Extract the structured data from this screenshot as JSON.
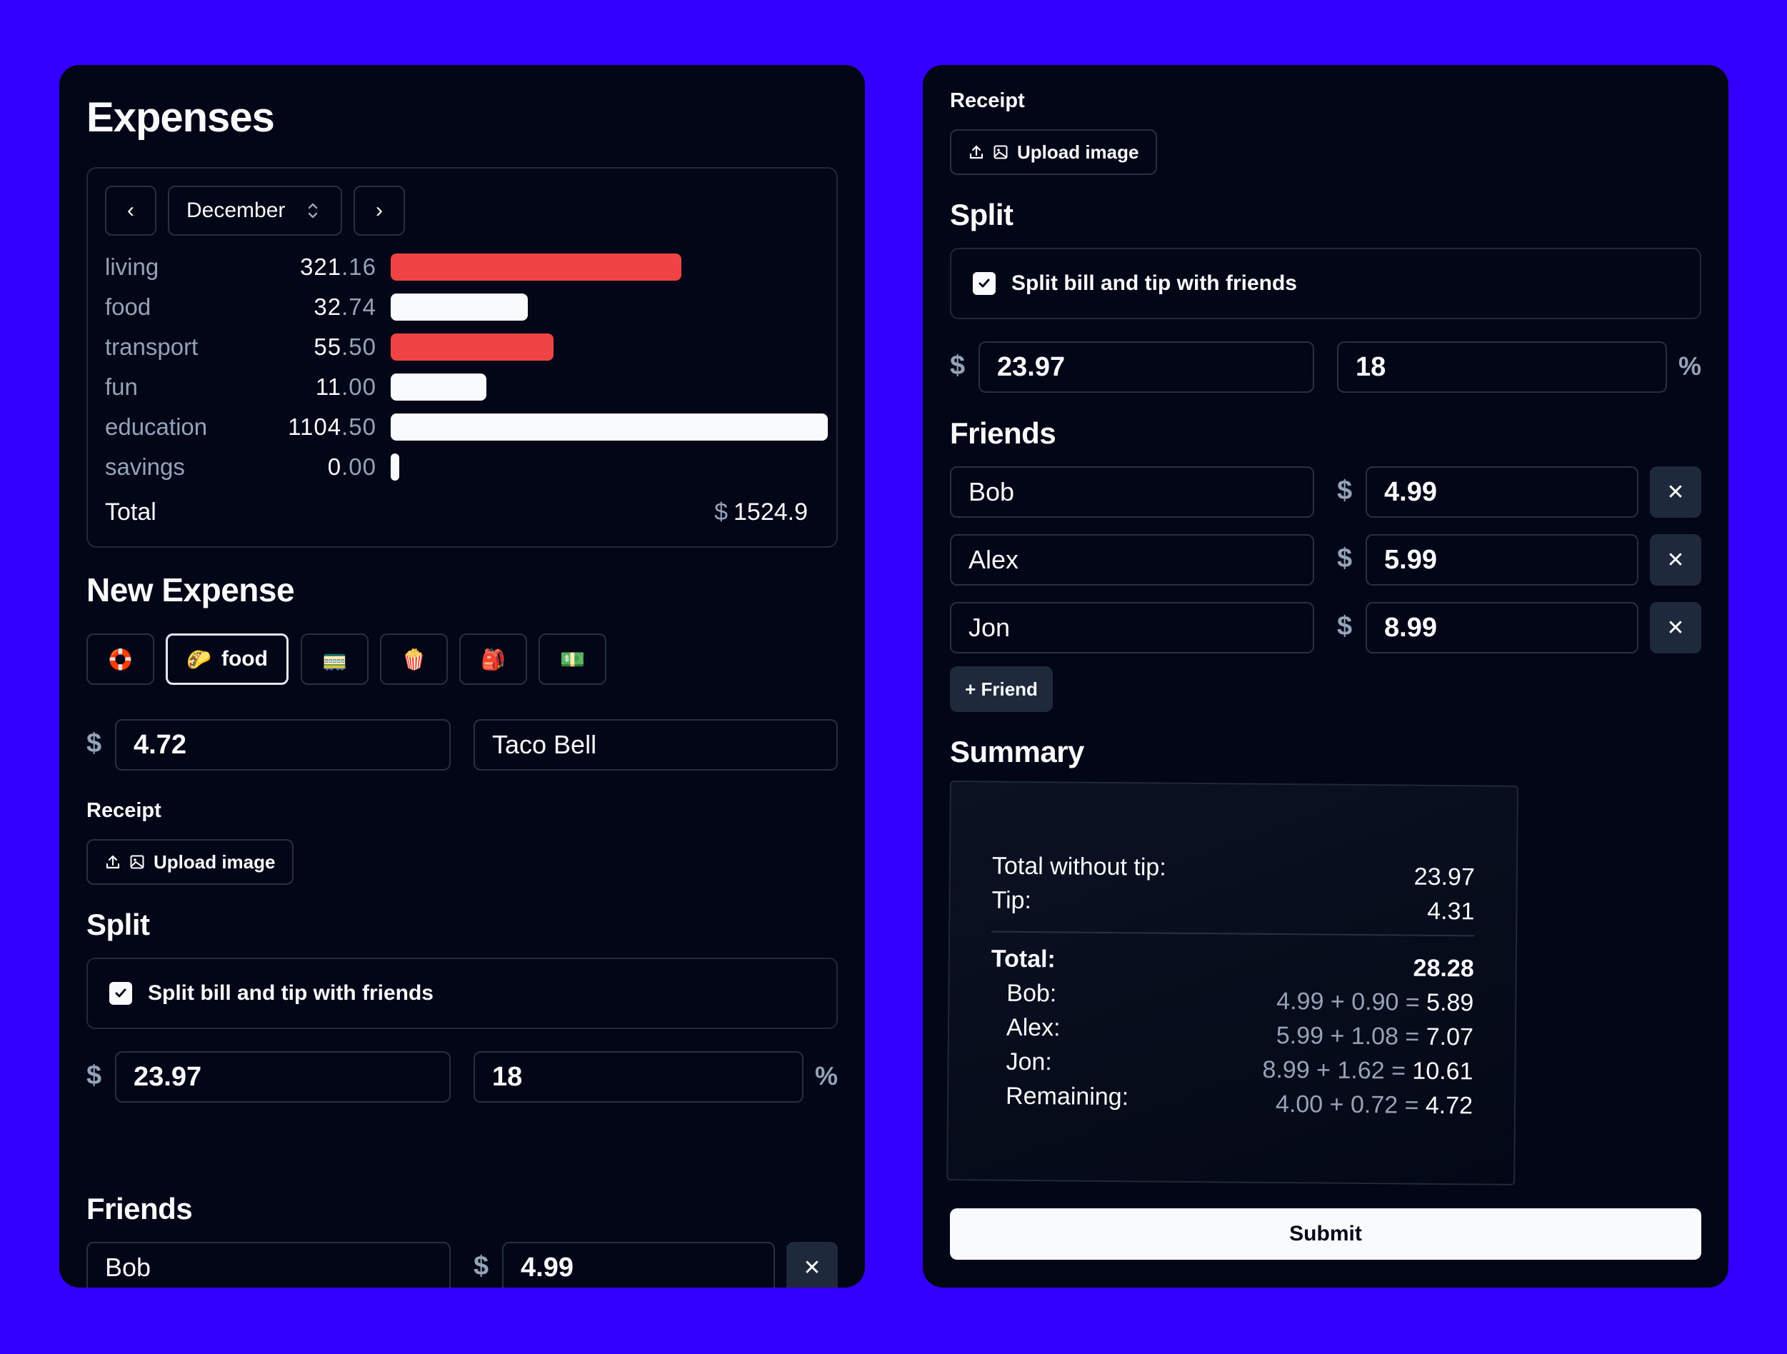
{
  "expenses": {
    "title": "Expenses",
    "month": "December",
    "prev_label": "‹",
    "next_label": "›",
    "categories": [
      {
        "name": "living",
        "int": "321",
        "dec": ".16",
        "color": "#ef4444"
      },
      {
        "name": "food",
        "int": "32",
        "dec": ".74",
        "color": "#f8fafc"
      },
      {
        "name": "transport",
        "int": "55",
        "dec": ".50",
        "color": "#ef4444"
      },
      {
        "name": "fun",
        "int": "11",
        "dec": ".00",
        "color": "#f8fafc"
      },
      {
        "name": "education",
        "int": "1104",
        "dec": ".50",
        "color": "#f8fafc"
      },
      {
        "name": "savings",
        "int": "0",
        "dec": ".00",
        "color": "#f8fafc"
      }
    ],
    "total_label": "Total",
    "total_currency": "$",
    "total_value": "1524.9"
  },
  "chart_data": {
    "type": "bar",
    "categories": [
      "living",
      "food",
      "transport",
      "fun",
      "education",
      "savings"
    ],
    "values": [
      321.16,
      32.74,
      55.5,
      11.0,
      1104.5,
      0.0
    ]
  },
  "new_expense": {
    "title": "New Expense",
    "category_buttons": [
      {
        "icon": "🛟",
        "label": ""
      },
      {
        "icon": "🌮",
        "label": "food"
      },
      {
        "icon": "🚃",
        "label": ""
      },
      {
        "icon": "🍿",
        "label": ""
      },
      {
        "icon": "🎒",
        "label": ""
      },
      {
        "icon": "💵",
        "label": ""
      }
    ],
    "currency": "$",
    "amount": "4.72",
    "description": "Taco Bell"
  },
  "receipt": {
    "label": "Receipt",
    "upload_label": "Upload image"
  },
  "split": {
    "title": "Split",
    "checkbox_label": "Split bill and tip with friends",
    "currency": "$",
    "amount": "23.97",
    "tip": "18",
    "percent": "%"
  },
  "friends": {
    "title": "Friends",
    "currency": "$",
    "remove_label": "✕",
    "add_label": "+ Friend",
    "list": [
      {
        "name": "Bob",
        "amount": "4.99"
      },
      {
        "name": "Alex",
        "amount": "5.99"
      },
      {
        "name": "Jon",
        "amount": "8.99"
      }
    ]
  },
  "summary": {
    "title": "Summary",
    "without_tip_label": "Total without tip:",
    "without_tip_value": "23.97",
    "tip_label": "Tip:",
    "tip_value": "4.31",
    "total_label": "Total:",
    "total_value": "28.28",
    "rows": [
      {
        "name": "Bob:",
        "formula": "4.99 + 0.90 =",
        "value": "5.89"
      },
      {
        "name": "Alex:",
        "formula": "5.99 + 1.08 =",
        "value": "7.07"
      },
      {
        "name": "Jon:",
        "formula": "8.99 + 1.62 =",
        "value": "10.61"
      },
      {
        "name": "Remaining:",
        "formula": "4.00 + 0.72 =",
        "value": "4.72"
      }
    ]
  },
  "submit_label": "Submit"
}
